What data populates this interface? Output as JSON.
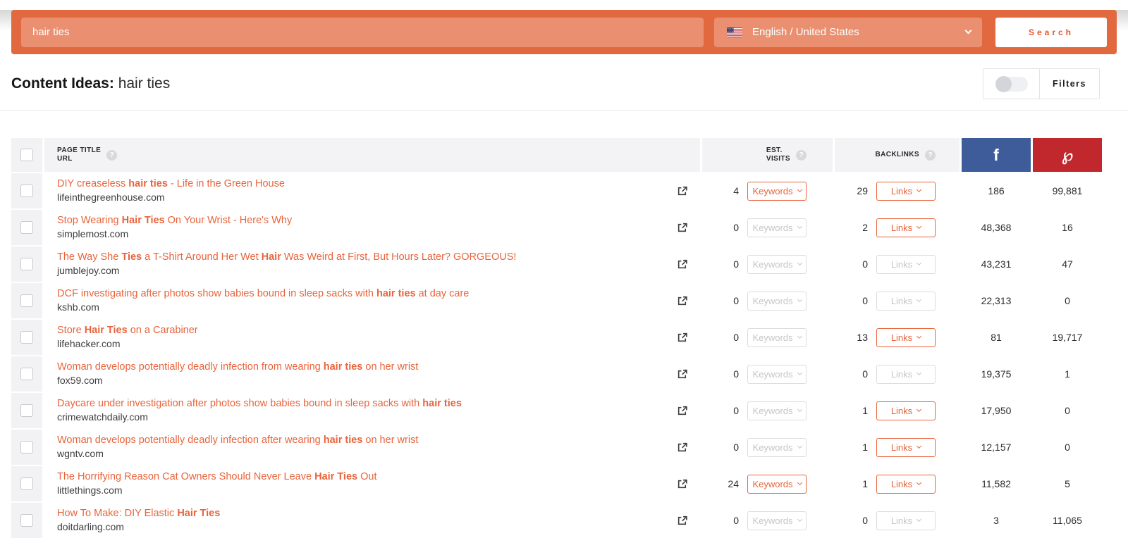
{
  "search_bar": {
    "query": "hair ties",
    "language": "English / United States",
    "search_label": "Search"
  },
  "header": {
    "title_prefix": "Content Ideas:",
    "title_query": "hair ties",
    "filters_label": "Filters",
    "filters_toggle_state": "off"
  },
  "colors": {
    "accent_orange": "#e8643c",
    "bar_orange": "#e2693f",
    "input_orange": "#ea9070",
    "facebook_blue": "#3e5c9a",
    "pinterest_red": "#c0282d"
  },
  "table": {
    "columns": {
      "page_title": "PAGE TITLE",
      "url": "URL",
      "est": "EST.",
      "visits": "VISITS",
      "backlinks": "BACKLINKS",
      "facebook_icon": "f",
      "pinterest_icon": "℘"
    },
    "keywords_label": "Keywords",
    "links_label": "Links",
    "rows": [
      {
        "title_segments": [
          {
            "text": "DIY creaseless ",
            "bold": false
          },
          {
            "text": "hair ties",
            "bold": true
          },
          {
            "text": " - Life in the Green House",
            "bold": false
          }
        ],
        "domain": "lifeinthegreenhouse.com",
        "est_visits": "4",
        "keywords_enabled": true,
        "backlinks": "29",
        "links_enabled": true,
        "facebook": "186",
        "pinterest": "99,881"
      },
      {
        "title_segments": [
          {
            "text": "Stop Wearing ",
            "bold": false
          },
          {
            "text": "Hair Ties",
            "bold": true
          },
          {
            "text": " On Your Wrist - Here's Why",
            "bold": false
          }
        ],
        "domain": "simplemost.com",
        "est_visits": "0",
        "keywords_enabled": false,
        "backlinks": "2",
        "links_enabled": true,
        "facebook": "48,368",
        "pinterest": "16"
      },
      {
        "title_segments": [
          {
            "text": "The Way She ",
            "bold": false
          },
          {
            "text": "Ties",
            "bold": true
          },
          {
            "text": " a T-Shirt Around Her Wet ",
            "bold": false
          },
          {
            "text": "Hair",
            "bold": true
          },
          {
            "text": " Was Weird at First, But Hours Later? GORGEOUS!",
            "bold": false
          }
        ],
        "domain": "jumblejoy.com",
        "est_visits": "0",
        "keywords_enabled": false,
        "backlinks": "0",
        "links_enabled": false,
        "facebook": "43,231",
        "pinterest": "47"
      },
      {
        "title_segments": [
          {
            "text": "DCF investigating after photos show babies bound in sleep sacks with ",
            "bold": false
          },
          {
            "text": "hair ties",
            "bold": true
          },
          {
            "text": " at day care",
            "bold": false
          }
        ],
        "domain": "kshb.com",
        "est_visits": "0",
        "keywords_enabled": false,
        "backlinks": "0",
        "links_enabled": false,
        "facebook": "22,313",
        "pinterest": "0"
      },
      {
        "title_segments": [
          {
            "text": "Store ",
            "bold": false
          },
          {
            "text": "Hair Ties",
            "bold": true
          },
          {
            "text": " on a Carabiner",
            "bold": false
          }
        ],
        "domain": "lifehacker.com",
        "est_visits": "0",
        "keywords_enabled": false,
        "backlinks": "13",
        "links_enabled": true,
        "facebook": "81",
        "pinterest": "19,717"
      },
      {
        "title_segments": [
          {
            "text": "Woman develops potentially deadly infection from wearing ",
            "bold": false
          },
          {
            "text": "hair ties",
            "bold": true
          },
          {
            "text": " on her wrist",
            "bold": false
          }
        ],
        "domain": "fox59.com",
        "est_visits": "0",
        "keywords_enabled": false,
        "backlinks": "0",
        "links_enabled": false,
        "facebook": "19,375",
        "pinterest": "1"
      },
      {
        "title_segments": [
          {
            "text": "Daycare under investigation after photos show babies bound in sleep sacks with ",
            "bold": false
          },
          {
            "text": "hair ties",
            "bold": true
          }
        ],
        "domain": "crimewatchdaily.com",
        "est_visits": "0",
        "keywords_enabled": false,
        "backlinks": "1",
        "links_enabled": true,
        "facebook": "17,950",
        "pinterest": "0"
      },
      {
        "title_segments": [
          {
            "text": "Woman develops potentially deadly infection after wearing ",
            "bold": false
          },
          {
            "text": "hair ties",
            "bold": true
          },
          {
            "text": " on her wrist",
            "bold": false
          }
        ],
        "domain": "wgntv.com",
        "est_visits": "0",
        "keywords_enabled": false,
        "backlinks": "1",
        "links_enabled": true,
        "facebook": "12,157",
        "pinterest": "0"
      },
      {
        "title_segments": [
          {
            "text": "The Horrifying Reason Cat Owners Should Never Leave ",
            "bold": false
          },
          {
            "text": "Hair Ties",
            "bold": true
          },
          {
            "text": " Out",
            "bold": false
          }
        ],
        "domain": "littlethings.com",
        "est_visits": "24",
        "keywords_enabled": true,
        "backlinks": "1",
        "links_enabled": true,
        "facebook": "11,582",
        "pinterest": "5"
      },
      {
        "title_segments": [
          {
            "text": "How To Make: DIY Elastic ",
            "bold": false
          },
          {
            "text": "Hair Ties",
            "bold": true
          }
        ],
        "domain": "doitdarling.com",
        "est_visits": "0",
        "keywords_enabled": false,
        "backlinks": "0",
        "links_enabled": false,
        "facebook": "3",
        "pinterest": "11,065"
      }
    ]
  }
}
